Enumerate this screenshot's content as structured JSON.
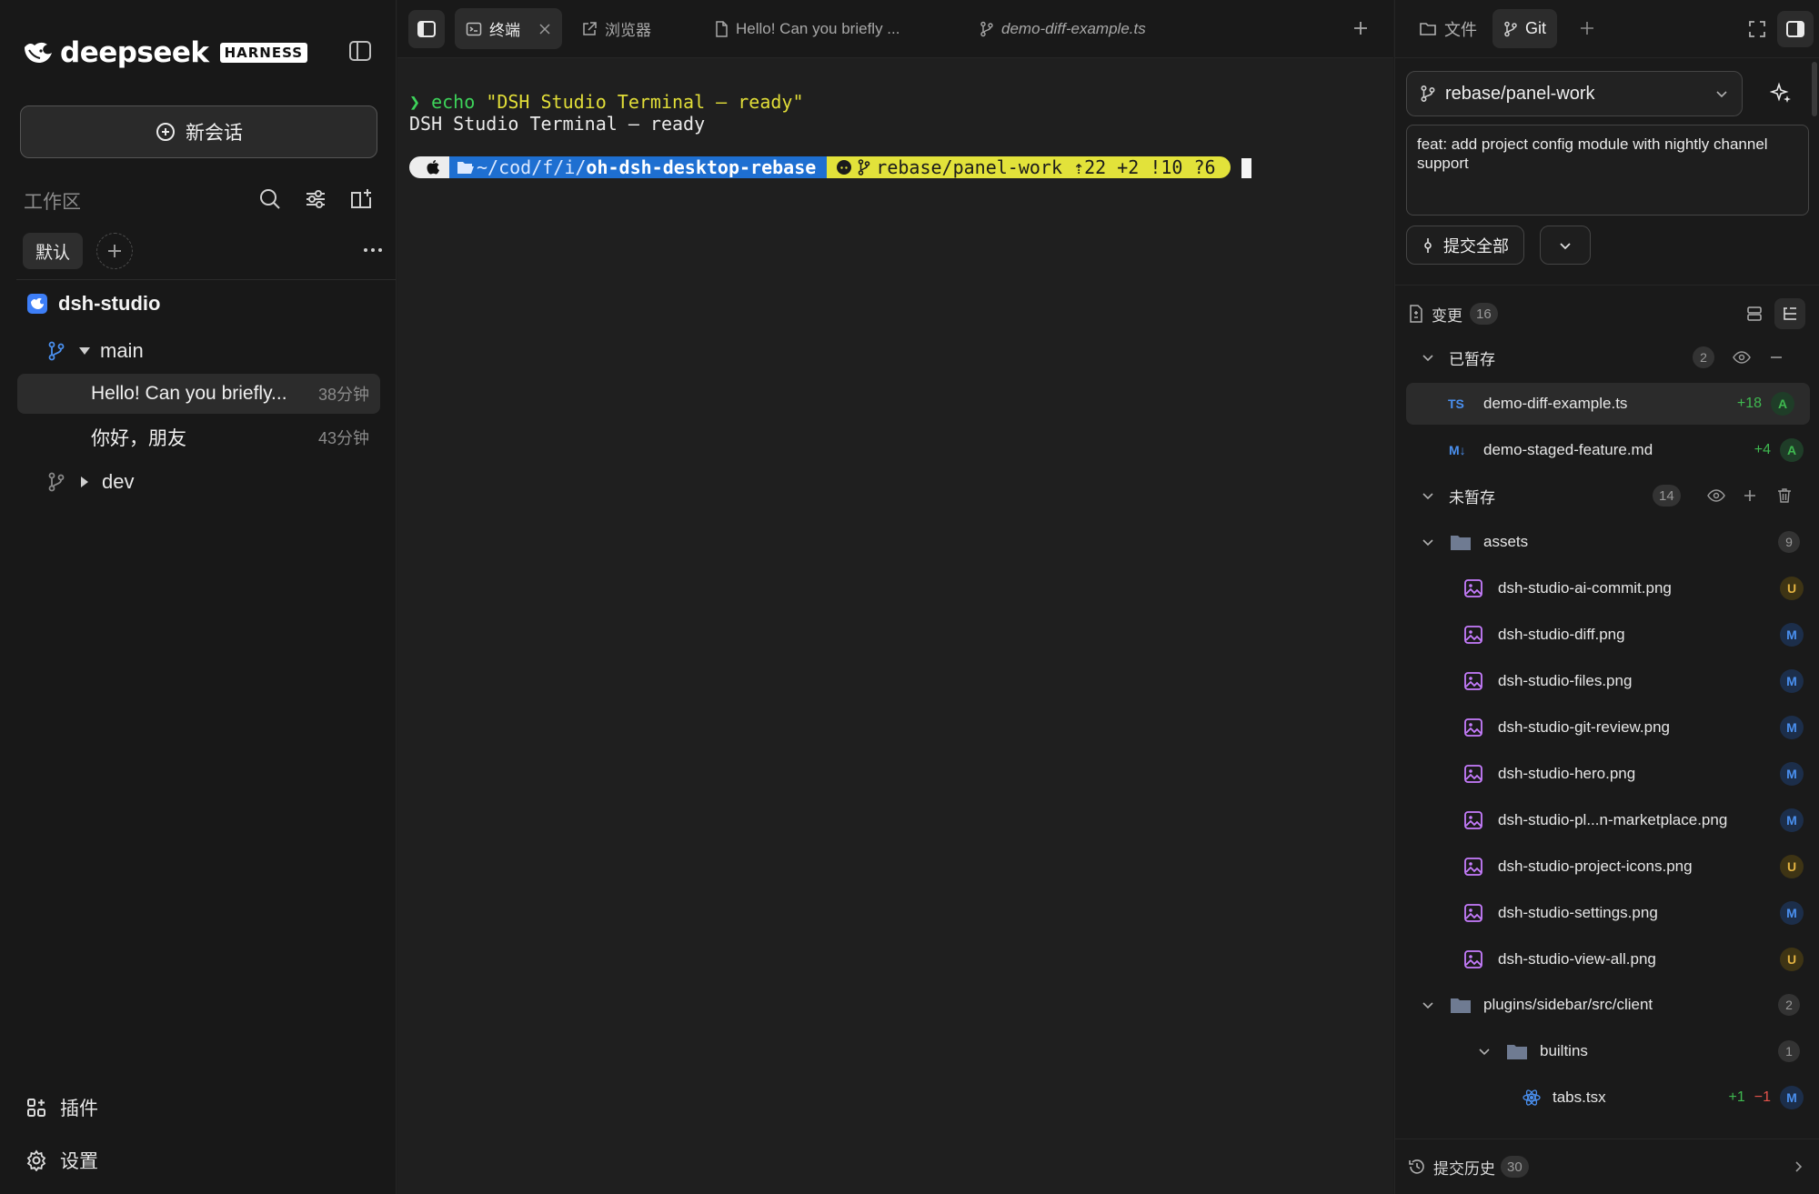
{
  "brand": {
    "name": "deepseek",
    "badge": "HARNESS"
  },
  "sidebar": {
    "new_chat_label": "新会话",
    "workspace_label": "工作区",
    "chips": [
      "默认"
    ],
    "project": {
      "name": "dsh-studio"
    },
    "branches": [
      {
        "name": "main",
        "expanded": true,
        "sessions": [
          {
            "title": "Hello! Can you briefly...",
            "time": "38分钟",
            "active": true
          },
          {
            "title": "你好，朋友",
            "time": "43分钟",
            "active": false
          }
        ]
      },
      {
        "name": "dev",
        "expanded": false,
        "sessions": []
      }
    ],
    "bottom": {
      "plugins_label": "插件",
      "settings_label": "设置"
    }
  },
  "tabs": [
    {
      "label": "终端",
      "icon": "terminal-icon",
      "active": true,
      "closable": true
    },
    {
      "label": "浏览器",
      "icon": "external-link-icon",
      "active": false
    },
    {
      "label": "Hello! Can you briefly ...",
      "icon": "file-icon",
      "active": false
    },
    {
      "label": "demo-diff-example.ts",
      "icon": "git-branch-icon",
      "active": false,
      "italic": true
    }
  ],
  "terminal": {
    "prompt_symbol": "❯",
    "command": "echo",
    "command_arg": "\"DSH Studio Terminal – ready\"",
    "output": "DSH Studio Terminal – ready",
    "ps1": {
      "apple": "",
      "path_prefix": "~/cod/f/i/",
      "path_dir": "oh-dsh-desktop-rebase",
      "git": "rebase/panel-work ⇡22 +2 !10 ?6"
    }
  },
  "git_panel": {
    "tabs": [
      {
        "label": "文件",
        "icon": "folder-icon"
      },
      {
        "label": "Git",
        "icon": "git-branch-icon",
        "active": true
      }
    ],
    "branch": "rebase/panel-work",
    "commit_message": "feat: add project config module with nightly channel support",
    "commit_label": "提交全部",
    "changes_label": "变更",
    "changes_count": "16",
    "staged": {
      "label": "已暂存",
      "count": "2",
      "files": [
        {
          "name": "demo-diff-example.ts",
          "type": "TS",
          "added": "+18",
          "status": "A",
          "selected": true
        },
        {
          "name": "demo-staged-feature.md",
          "type": "M↓",
          "added": "+4",
          "status": "A"
        }
      ]
    },
    "unstaged": {
      "label": "未暂存",
      "count": "14",
      "folders": [
        {
          "name": "assets",
          "count": "9",
          "files": [
            {
              "name": "dsh-studio-ai-commit.png",
              "status": "U"
            },
            {
              "name": "dsh-studio-diff.png",
              "status": "M"
            },
            {
              "name": "dsh-studio-files.png",
              "status": "M"
            },
            {
              "name": "dsh-studio-git-review.png",
              "status": "M"
            },
            {
              "name": "dsh-studio-hero.png",
              "status": "M"
            },
            {
              "name": "dsh-studio-pl...n-marketplace.png",
              "status": "M"
            },
            {
              "name": "dsh-studio-project-icons.png",
              "status": "U"
            },
            {
              "name": "dsh-studio-settings.png",
              "status": "M"
            },
            {
              "name": "dsh-studio-view-all.png",
              "status": "U"
            }
          ]
        },
        {
          "name": "plugins/sidebar/src/client",
          "count": "2",
          "subfolder": {
            "name": "builtins",
            "count": "1",
            "files": [
              {
                "name": "tabs.tsx",
                "added": "+1",
                "removed": "−1",
                "status": "M"
              }
            ]
          }
        }
      ]
    },
    "history_label": "提交历史",
    "history_count": "30"
  },
  "colors": {
    "accent_blue": "#3d7ef7",
    "added": "#3fb950",
    "modified": "#4a90f0",
    "untracked": "#e3b341",
    "deleted": "#e5534b",
    "ps1_path_bg": "#1e6fd1",
    "ps1_git_bg": "#e2e23a"
  }
}
